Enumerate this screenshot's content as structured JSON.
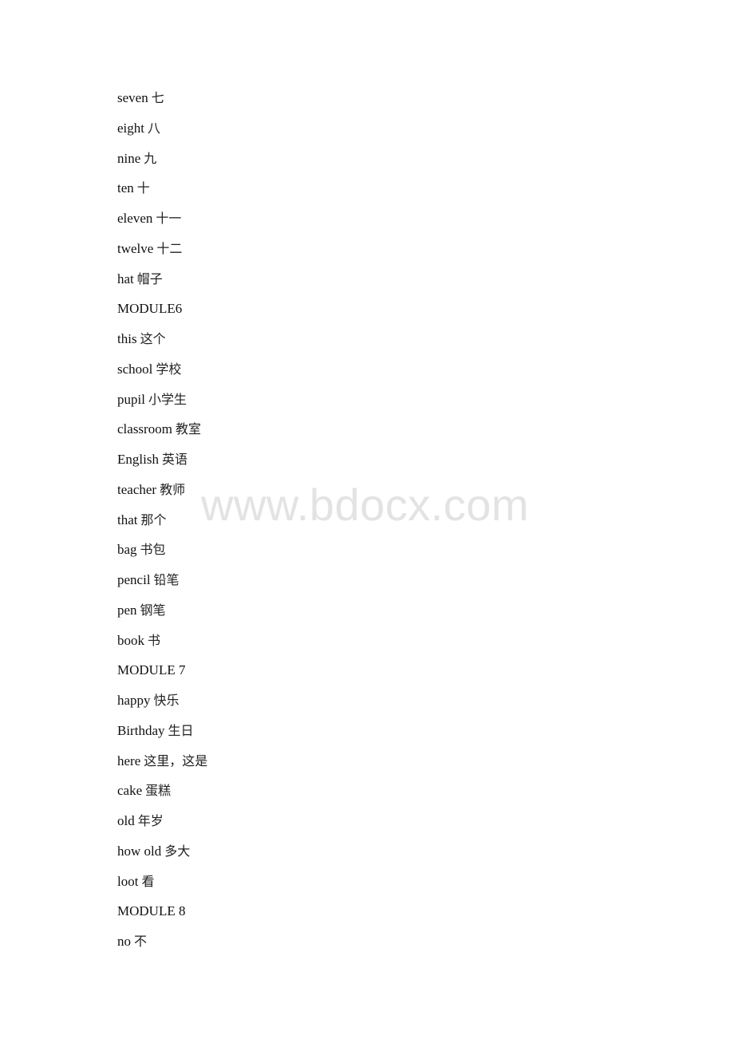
{
  "document": {
    "entries": [
      {
        "en": "seven",
        "zh": "七"
      },
      {
        "en": "eight",
        "zh": "八"
      },
      {
        "en": "nine",
        "zh": "九"
      },
      {
        "en": "ten",
        "zh": "十"
      },
      {
        "en": "eleven",
        "zh": "十一"
      },
      {
        "en": "twelve",
        "zh": "十二"
      },
      {
        "en": "hat",
        "zh": "帽子"
      },
      {
        "en": "MODULE6",
        "zh": ""
      },
      {
        "en": "this",
        "zh": "这个"
      },
      {
        "en": "school",
        "zh": "学校"
      },
      {
        "en": "pupil",
        "zh": "小学生"
      },
      {
        "en": "classroom",
        "zh": "教室"
      },
      {
        "en": "English",
        "zh": "英语"
      },
      {
        "en": "teacher",
        "zh": "教师"
      },
      {
        "en": "that",
        "zh": "那个"
      },
      {
        "en": "bag",
        "zh": "书包"
      },
      {
        "en": "pencil",
        "zh": "铅笔"
      },
      {
        "en": "pen",
        "zh": "钢笔"
      },
      {
        "en": "book",
        "zh": "书"
      },
      {
        "en": "MODULE 7",
        "zh": ""
      },
      {
        "en": "happy",
        "zh": "快乐"
      },
      {
        "en": "Birthday",
        "zh": "生日"
      },
      {
        "en": "here",
        "zh": "这里，这是"
      },
      {
        "en": "cake",
        "zh": "蛋糕"
      },
      {
        "en": "old",
        "zh": "年岁"
      },
      {
        "en": "how old",
        "zh": "多大"
      },
      {
        "en": "loot",
        "zh": "看"
      },
      {
        "en": "MODULE 8",
        "zh": ""
      },
      {
        "en": "no",
        "zh": "不"
      }
    ]
  },
  "watermark": {
    "text": "www.bdocx.com"
  }
}
